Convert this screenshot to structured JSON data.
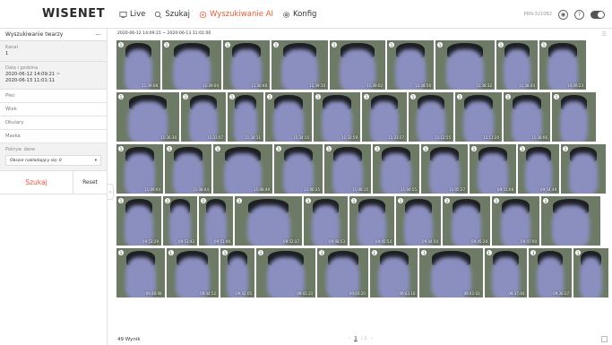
{
  "brand": "WISENET",
  "nav": [
    {
      "label": "Live",
      "icon": "monitor-icon",
      "active": false
    },
    {
      "label": "Szukaj",
      "icon": "search-icon",
      "active": false
    },
    {
      "label": "Wyszukiwanie AI",
      "icon": "ai-search-icon",
      "active": true
    },
    {
      "label": "Konfig",
      "icon": "gear-icon",
      "active": false
    }
  ],
  "topright": {
    "model": "PRN-3210B2",
    "help_icon": "question-icon",
    "user_icon": "user-icon",
    "toggle_icon": "wisenet-toggle-icon"
  },
  "panel": {
    "title": "Wyszukiwanie twarzy",
    "menu_glyph": "···",
    "channel_label": "Kanał",
    "channel_value": "1",
    "datetime_label": "Data i godzina",
    "datetime_value": "2020-06-12 14:09:21 ~\n2020-06-13 11:01:11",
    "filters": [
      "Płeć",
      "Wiek",
      "Okulary",
      "Maska"
    ],
    "coverage_label": "Pokryw. dane",
    "coverage_value": "Obszar nakładający się: 0",
    "search_label": "Szukaj",
    "reset_label": "Reset"
  },
  "results": {
    "range": "2020-06-12 14:09:21 ~ 2020-06-13 11:01:00",
    "count": "49 Wynik",
    "page_current": "1",
    "page_total": "/ 1",
    "thumb_timestamps": [
      [
        "11:39:08",
        "11:39:04",
        "11:30:48",
        "11:39:10",
        "11:39:02",
        "11:38:56",
        "11:38:32",
        "11:38:44",
        "14:09:23"
      ],
      [
        "11:36:30",
        "11:33:07",
        "11:34:11",
        "11:34:15",
        "11:32:59",
        "11:33:27",
        "11:12:55",
        "11:11:20",
        "11:38:06"
      ],
      [
        "11:09:04",
        "11:08:44",
        "11:08:49",
        "11:06:25",
        "11:06:15",
        "11:04:55",
        "11:05:27",
        "09:51:08",
        "09:54:49"
      ],
      [
        "09:53:29",
        "09:53:42",
        "09:51:46",
        "09:52:37",
        "09:48:53",
        "09:45:54",
        "09:44:50",
        "09:45:28",
        "09:47:00"
      ],
      [
        "09:46:08",
        "09:44:52",
        "09:42:05",
        "09:41:21",
        "09:44:20",
        "09:43:16",
        "09:41:03",
        "09:37:44",
        "09:36:27"
      ]
    ],
    "thumb_colors": {
      "background": "#6d7a66",
      "face": "#8a8fc0",
      "hair": "#1d1f24"
    }
  }
}
